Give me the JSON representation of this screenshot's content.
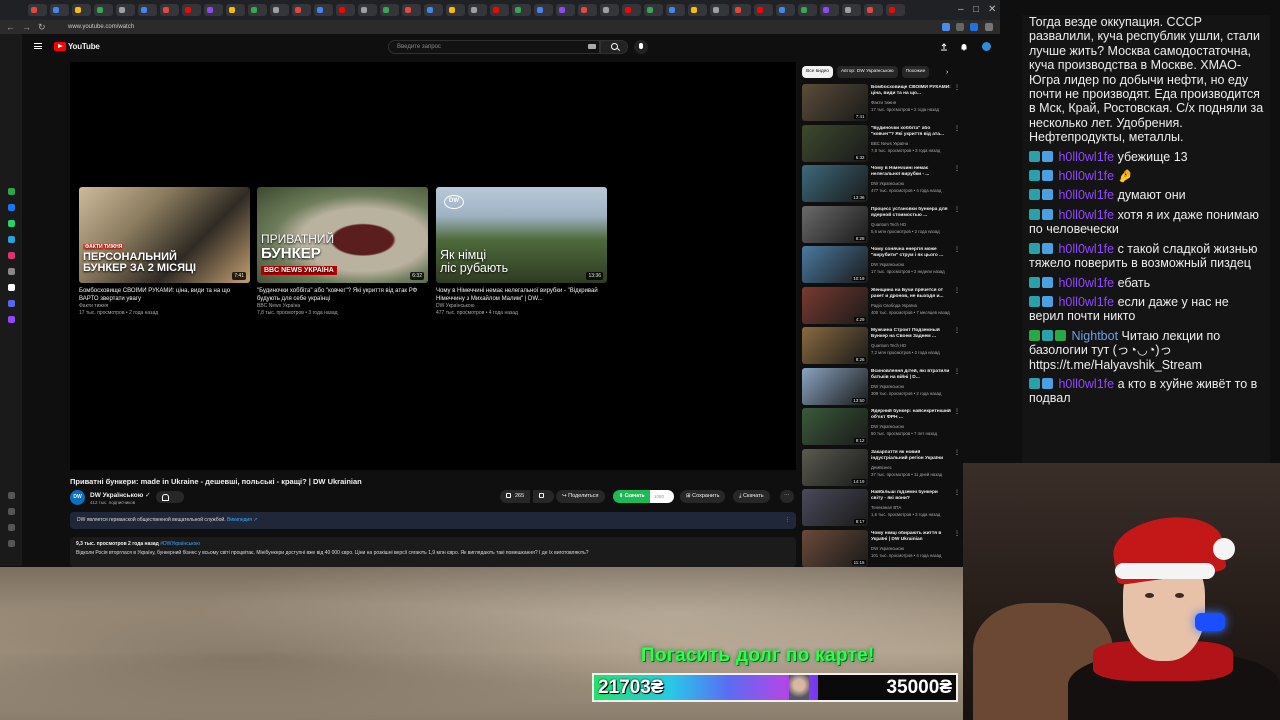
{
  "browser": {
    "url": "www.youtube.com/watch",
    "tab_colors": [
      "#e8453c",
      "#4285f4",
      "#fbbc05",
      "#34a853",
      "#9aa0a6",
      "#4285f4",
      "#e8453c",
      "#ff0000",
      "#9146ff",
      "#fbbc05",
      "#34a853",
      "#9aa0a6",
      "#e8453c",
      "#4285f4",
      "#ff0000",
      "#9aa0a6",
      "#34a853",
      "#e8453c",
      "#4285f4",
      "#fbbc05",
      "#9aa0a6",
      "#ff0000",
      "#34a853",
      "#4285f4",
      "#9146ff",
      "#e8453c",
      "#9aa0a6",
      "#ff0000",
      "#34a853",
      "#4285f4",
      "#fbbc05",
      "#9aa0a6",
      "#e8453c",
      "#ff0000",
      "#4285f4",
      "#34a853",
      "#9146ff",
      "#9aa0a6",
      "#e8453c",
      "#ff0000"
    ]
  },
  "youtube": {
    "logo_text": "YouTube",
    "search_placeholder": "Введите запрос"
  },
  "endcards": [
    {
      "overlay_line1": "ПЕРСОНАЛЬНИЙ",
      "overlay_line2": "БУНКЕР ЗА 2 МІСЯЦІ",
      "overlay_tag": "ФАКТИ ТИЖНЯ",
      "duration": "7:41",
      "title": "Бомбосховище СВОЇМИ РУКАМИ: ціна, види та на що ВАРТО звертати увагу",
      "channel": "Факти тижня",
      "meta": "17 тыс. просмотров • 2 года назад"
    },
    {
      "overlay_line1": "ПРИВАТНИЙ",
      "overlay_line2": "БУНКЕР",
      "overlay_tag": "BBC NEWS УКРАЇНА",
      "duration": "6:32",
      "title": "\"Будиночки хоббіта\" або \"ковчег\"? Які укриття від атак РФ будують для себе українці",
      "channel": "BBC News Україна",
      "meta": "7,8 тыс. просмотров • 3 года назад"
    },
    {
      "overlay_line1": "Як німці",
      "overlay_line2": "ліс рубають",
      "overlay_tag": "DW",
      "duration": "13:36",
      "title": "Чому в Німеччині немає нелегальної вирубки - \"Відкривай Німеччину з Михайлом Малим\" | DW...",
      "channel": "DW Українською",
      "meta": "477 тыс. просмотров • 4 года назад"
    }
  ],
  "video": {
    "title": "Приватні бункери: made in Ukraine - дешевші, польські - кращі? | DW Ukrainian",
    "channel": "DW Українською",
    "avatar_text": "DW",
    "subscribers": "412 тыс. подписчиков",
    "likes": "265",
    "share": "Поделиться",
    "download": "Скачать",
    "download_badge": "1080",
    "save": "Сохранить",
    "clip": "Скачать",
    "info_banner": "DW является германской общественной вещательной службой.",
    "info_link": "Википедия",
    "desc_meta": "9,3 тыс. просмотров  2 года назад",
    "desc_tag": "#DWУкраїнською",
    "desc_text": "Відколи Росія вторглася в Україну, бункерний бізнес у всьому світі процвітає. Мінібункери доступні вже від 40 000 євро. Ціни на розкішні версії сягають 1,9 млн євро. Як виглядають такі помешкання? І де їх виготовляють?"
  },
  "chips": [
    "Все видео",
    "Автор: DW Українською",
    "Похожие"
  ],
  "recommendations": [
    {
      "title": "Бомбосховище СВОЇМИ РУКАМИ: ціна, види та на що...",
      "channel": "Факти тижня",
      "meta": "17 тыс. просмотров • 2 года назад",
      "duration": "7:41",
      "color": "#5a4d3a"
    },
    {
      "title": "\"Будиночки хоббіта\" або \"ковчег\"? Які укриття від ата...",
      "channel": "BBC News Україна",
      "meta": "7,8 тыс. просмотров • 3 года назад",
      "duration": "6:32",
      "color": "#3d4a2e"
    },
    {
      "title": "Чому в Німеччині немає нелегальної вирубки - ...",
      "channel": "DW Українською",
      "meta": "477 тыс. просмотров • 4 года назад",
      "duration": "13:36",
      "color": "#3c6a7a"
    },
    {
      "title": "Процесс установки бункера для ядерной стоимостью ...",
      "channel": "Quantum Tech HD",
      "meta": "5,6 млн просмотров • 2 года назад",
      "duration": "8:28",
      "color": "#6a6a6a"
    },
    {
      "title": "Чому сонячна енергія може \"вирубити\" струм і як цього ...",
      "channel": "DW Українською",
      "meta": "17 тыс. просмотров • 2 недели назад",
      "duration": "10:19",
      "color": "#4a7aa0"
    },
    {
      "title": "Женщина на Бучи прячется от ракет и дронов, не выходя и...",
      "channel": "Радіо Свобода Україна",
      "meta": "400 тыс. просмотров • 7 месяцев назад",
      "duration": "4:29",
      "color": "#7a3a30"
    },
    {
      "title": "Мужчина Строит Подземный Бункер на Своем Заднем ...",
      "channel": "Quantum Tech HD",
      "meta": "7,2 млн просмотров • 2 года назад",
      "duration": "8:26",
      "color": "#8a6a40"
    },
    {
      "title": "Всиновлення дітей, які втратили батьків на війні | D...",
      "channel": "DW Українською",
      "meta": "309 тыс. просмотров • 2 года назад",
      "duration": "13:50",
      "color": "#8aa4c0"
    },
    {
      "title": "Ядерний бункер: найсекретніший об'єкт ФРН ...",
      "channel": "DW Українською",
      "meta": "50 тыс. просмотров • 7 лет назад",
      "duration": "9:12",
      "color": "#3a5a3a"
    },
    {
      "title": "Закарпаття як новий індустріальний регіон України",
      "channel": "ДемБізнес",
      "meta": "37 тыс. просмотров • 11 дней назад",
      "duration": "14:19",
      "color": "#5a5a50"
    },
    {
      "title": "Найбільші підземні бункери світу - які вони?",
      "channel": "Телеканал ВТА",
      "meta": "1,6 тыс. просмотров • 3 года назад",
      "duration": "8:17",
      "color": "#4a4a5a"
    },
    {
      "title": "Чому німці обирають життя в Україні | DW Ukrainian",
      "channel": "DW Українською",
      "meta": "101 тыс. просмотров • 4 года назад",
      "duration": "11:15",
      "color": "#6a4a3a"
    }
  ],
  "overlay": {
    "debt_text": "Погасить долг по карте!",
    "goal_current": "21703₴",
    "goal_target": "35000₴",
    "goal_fraction": 0.62
  },
  "chat": {
    "top_text": "Тогда везде оккупация. СССР развалили, куча республик ушли, стали лучше жить? Москва самодостаточна, куча производства в Москве. ХМАО-Югра лидер по добычи нефти, но еду почти не производят. Еда производится в Мск, Край, Ростовская. С/х подняли за несколько лет. Удобрения. Нефтепродукты, металлы.",
    "messages": [
      {
        "user": "h0ll0wl1fe",
        "text": "убежище 13"
      },
      {
        "user": "h0ll0wl1fe",
        "text": "🤌"
      },
      {
        "user": "h0ll0wl1fe",
        "text": "думают они"
      },
      {
        "user": "h0ll0wl1fe",
        "text": "хотя я их даже понимаю по человечески"
      },
      {
        "user": "h0ll0wl1fe",
        "text": "с такой сладкой жизнью тяжело поверить в возможный пиздец"
      },
      {
        "user": "h0ll0wl1fe",
        "text": "ебать"
      },
      {
        "user": "h0ll0wl1fe",
        "text": "если даже у нас не верил почти никто"
      },
      {
        "user": "Nightbot",
        "text": "Читаю лекции по базологии тут (っ◔◡◔)っ https://t.me/Halyavshik_Stream"
      },
      {
        "user": "h0ll0wl1fe",
        "text": "а кто в хуйне живёт то в подвал"
      }
    ]
  }
}
